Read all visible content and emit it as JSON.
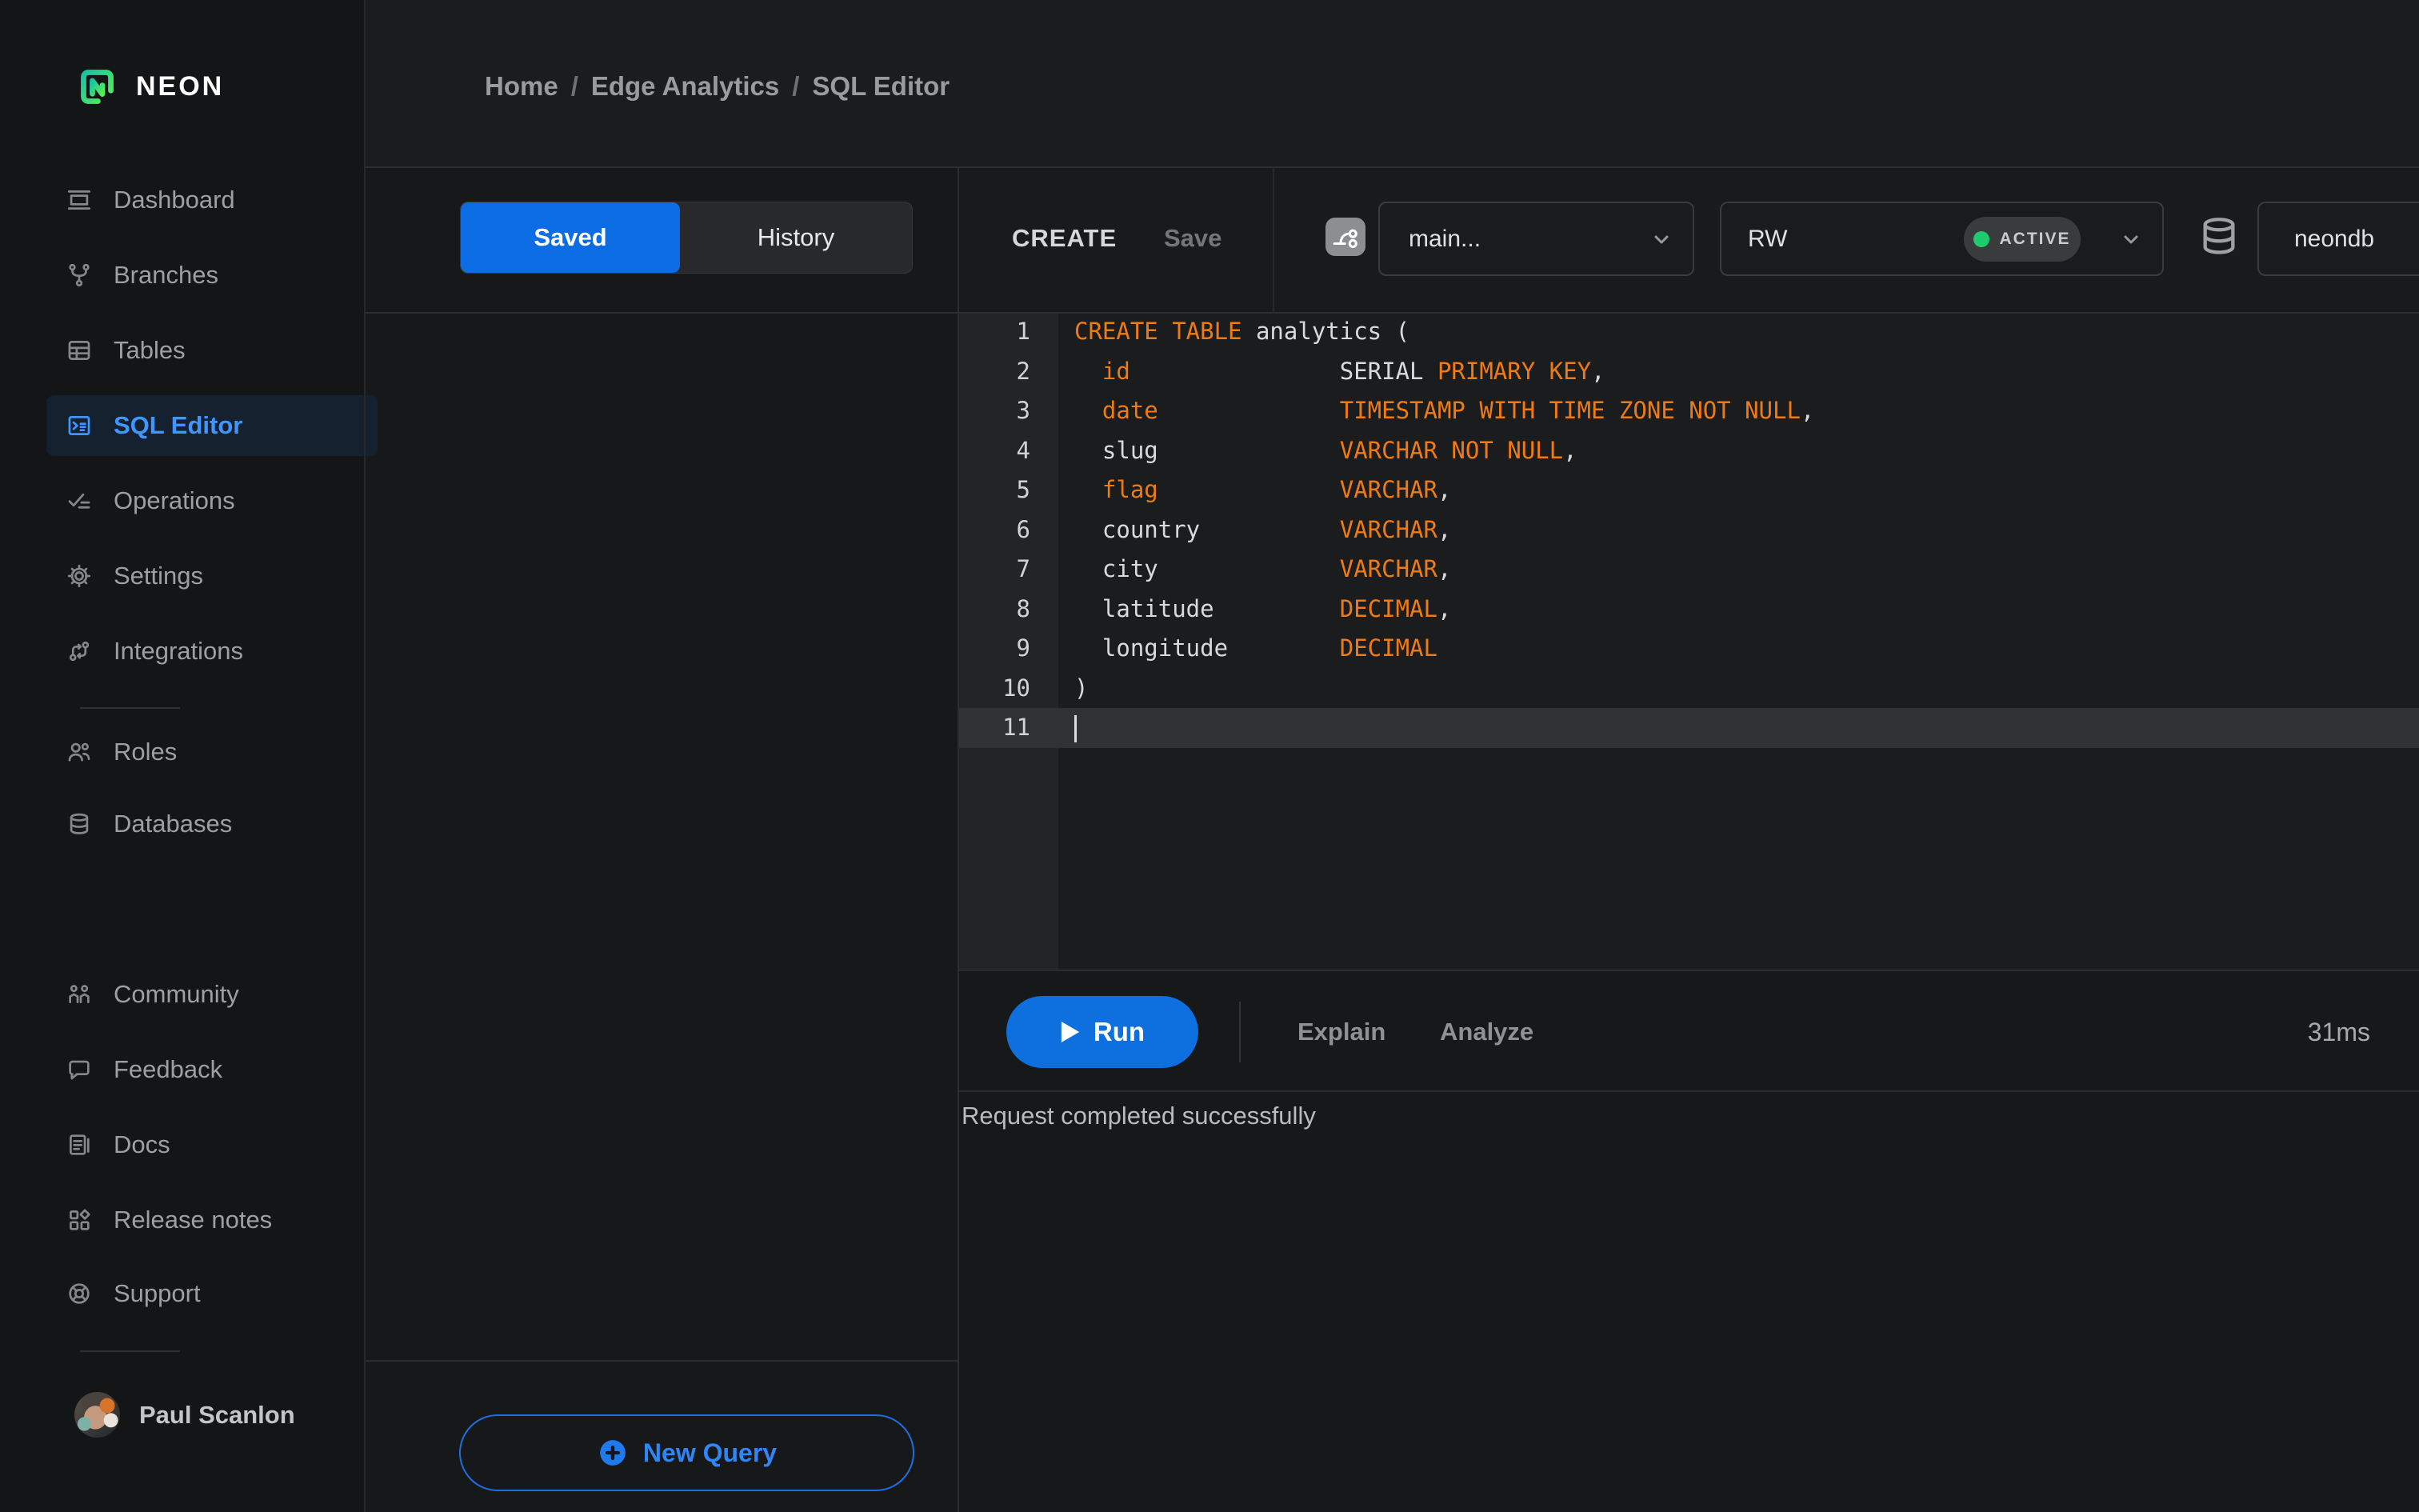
{
  "brand": {
    "name": "NEON"
  },
  "breadcrumb": {
    "items": [
      "Home",
      "Edge Analytics",
      "SQL Editor"
    ],
    "separator": "/"
  },
  "sidebar": {
    "items": [
      {
        "label": "Dashboard"
      },
      {
        "label": "Branches"
      },
      {
        "label": "Tables"
      },
      {
        "label": "SQL Editor",
        "active": true
      },
      {
        "label": "Operations"
      },
      {
        "label": "Settings"
      },
      {
        "label": "Integrations"
      },
      {
        "label": "Roles"
      },
      {
        "label": "Databases"
      },
      {
        "label": "Community"
      },
      {
        "label": "Feedback"
      },
      {
        "label": "Docs"
      },
      {
        "label": "Release notes"
      },
      {
        "label": "Support"
      }
    ],
    "user": {
      "name": "Paul Scanlon"
    }
  },
  "query_panel": {
    "tabs": [
      {
        "label": "Saved",
        "active": true
      },
      {
        "label": "History",
        "active": false
      }
    ],
    "new_query_label": "New Query"
  },
  "editor": {
    "title": "CREATE",
    "save_label": "Save",
    "branch_select": {
      "value": "main..."
    },
    "endpoint_select": {
      "value": "RW",
      "status": "ACTIVE"
    },
    "database_select": {
      "value": "neondb"
    },
    "code": {
      "language": "sql",
      "active_line": 11,
      "lines": [
        [
          {
            "t": "CREATE TABLE",
            "c": "kw"
          },
          {
            "t": " analytics (",
            "c": "pl"
          }
        ],
        [
          {
            "t": "  ",
            "c": "pl"
          },
          {
            "t": "id",
            "c": "kw"
          },
          {
            "t": "               ",
            "c": "pl"
          },
          {
            "t": "SERIAL ",
            "c": "pl"
          },
          {
            "t": "PRIMARY KEY",
            "c": "kw"
          },
          {
            "t": ",",
            "c": "pl"
          }
        ],
        [
          {
            "t": "  ",
            "c": "pl"
          },
          {
            "t": "date",
            "c": "kw"
          },
          {
            "t": "             ",
            "c": "pl"
          },
          {
            "t": "TIMESTAMP WITH TIME ZONE NOT NULL",
            "c": "kw"
          },
          {
            "t": ",",
            "c": "pl"
          }
        ],
        [
          {
            "t": "  slug",
            "c": "pl"
          },
          {
            "t": "             ",
            "c": "pl"
          },
          {
            "t": "VARCHAR NOT NULL",
            "c": "kw"
          },
          {
            "t": ",",
            "c": "pl"
          }
        ],
        [
          {
            "t": "  ",
            "c": "pl"
          },
          {
            "t": "flag",
            "c": "kw"
          },
          {
            "t": "             ",
            "c": "pl"
          },
          {
            "t": "VARCHAR",
            "c": "kw"
          },
          {
            "t": ",",
            "c": "pl"
          }
        ],
        [
          {
            "t": "  country",
            "c": "pl"
          },
          {
            "t": "          ",
            "c": "pl"
          },
          {
            "t": "VARCHAR",
            "c": "kw"
          },
          {
            "t": ",",
            "c": "pl"
          }
        ],
        [
          {
            "t": "  city",
            "c": "pl"
          },
          {
            "t": "             ",
            "c": "pl"
          },
          {
            "t": "VARCHAR",
            "c": "kw"
          },
          {
            "t": ",",
            "c": "pl"
          }
        ],
        [
          {
            "t": "  latitude",
            "c": "pl"
          },
          {
            "t": "         ",
            "c": "pl"
          },
          {
            "t": "DECIMAL",
            "c": "kw"
          },
          {
            "t": ",",
            "c": "pl"
          }
        ],
        [
          {
            "t": "  longitude",
            "c": "pl"
          },
          {
            "t": "        ",
            "c": "pl"
          },
          {
            "t": "DECIMAL",
            "c": "kw"
          }
        ],
        [
          {
            "t": ")",
            "c": "pl"
          }
        ],
        []
      ]
    },
    "toolbar": {
      "run_label": "Run",
      "explain_label": "Explain",
      "analyze_label": "Analyze",
      "duration": "31ms"
    },
    "result_message": "Request completed successfully"
  },
  "colors": {
    "accent_blue": "#0d6ee0",
    "active_nav_blue": "#4096ff",
    "keyword_orange": "#ef7b14",
    "status_green": "#1ecb6e",
    "logo_green_start": "#18c3a3",
    "logo_green_end": "#55f152"
  }
}
